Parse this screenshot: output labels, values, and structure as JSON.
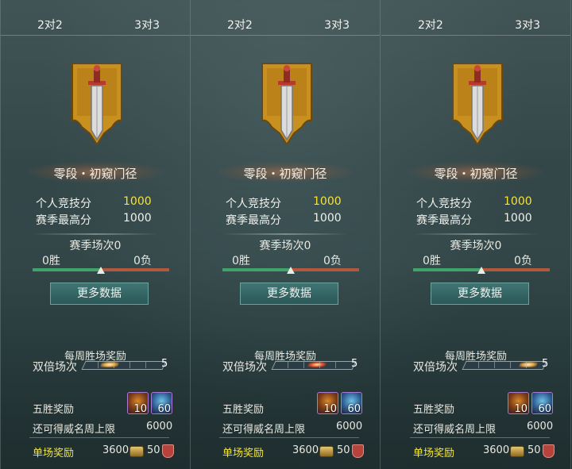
{
  "panels": [
    {
      "tab_left": "2对2",
      "tab_right": "3对3",
      "rank_name": "零段・初窥门径",
      "personal_score_label": "个人竞技分",
      "personal_score_value": "1000",
      "season_high_label": "赛季最高分",
      "season_high_value": "1000",
      "season_matches_label": "赛季场次0",
      "wins": "0胜",
      "losses": "0负",
      "win_ratio": 0.5,
      "more_data_button": "更多数据",
      "weekly_reward_title": "每周胜场奖励",
      "double_label": "双倍场次",
      "double_count": "5",
      "five_win_label": "五胜奖励",
      "item1_count": "10",
      "item2_count": "60",
      "cap_label": "还可得威名周上限",
      "cap_value": "6000",
      "single_label": "单场奖励",
      "single_value1": "3600",
      "single_value2": "50"
    },
    {
      "tab_left": "2对2",
      "tab_right": "3对3",
      "rank_name": "零段・初窥门径",
      "personal_score_label": "个人竞技分",
      "personal_score_value": "1000",
      "season_high_label": "赛季最高分",
      "season_high_value": "1000",
      "season_matches_label": "赛季场次0",
      "wins": "0胜",
      "losses": "0负",
      "win_ratio": 0.5,
      "more_data_button": "更多数据",
      "weekly_reward_title": "每周胜场奖励",
      "double_label": "双倍场次",
      "double_count": "5",
      "five_win_label": "五胜奖励",
      "item1_count": "10",
      "item2_count": "60",
      "cap_label": "还可得威名周上限",
      "cap_value": "6000",
      "single_label": "单场奖励",
      "single_value1": "3600",
      "single_value2": "50"
    },
    {
      "tab_left": "2对2",
      "tab_right": "3对3",
      "rank_name": "零段・初窥门径",
      "personal_score_label": "个人竞技分",
      "personal_score_value": "1000",
      "season_high_label": "赛季最高分",
      "season_high_value": "1000",
      "season_matches_label": "赛季场次0",
      "wins": "0胜",
      "losses": "0负",
      "win_ratio": 0.5,
      "more_data_button": "更多数据",
      "weekly_reward_title": "每周胜场奖励",
      "double_label": "双倍场次",
      "double_count": "5",
      "five_win_label": "五胜奖励",
      "item1_count": "10",
      "item2_count": "60",
      "cap_label": "还可得威名周上限",
      "cap_value": "6000",
      "single_label": "单场奖励",
      "single_value1": "3600",
      "single_value2": "50"
    }
  ],
  "colors": {
    "accent_yellow": "#f5e23a",
    "win_green": "#3fa36a",
    "loss_red": "#b0593f",
    "button_teal": "#3f7574"
  },
  "icons": {
    "emblem": "sword-banner-icon",
    "item1": "orange-tiger-item-icon",
    "item2": "blue-sword-item-icon",
    "coin": "coin-icon",
    "shield": "shield-icon"
  }
}
